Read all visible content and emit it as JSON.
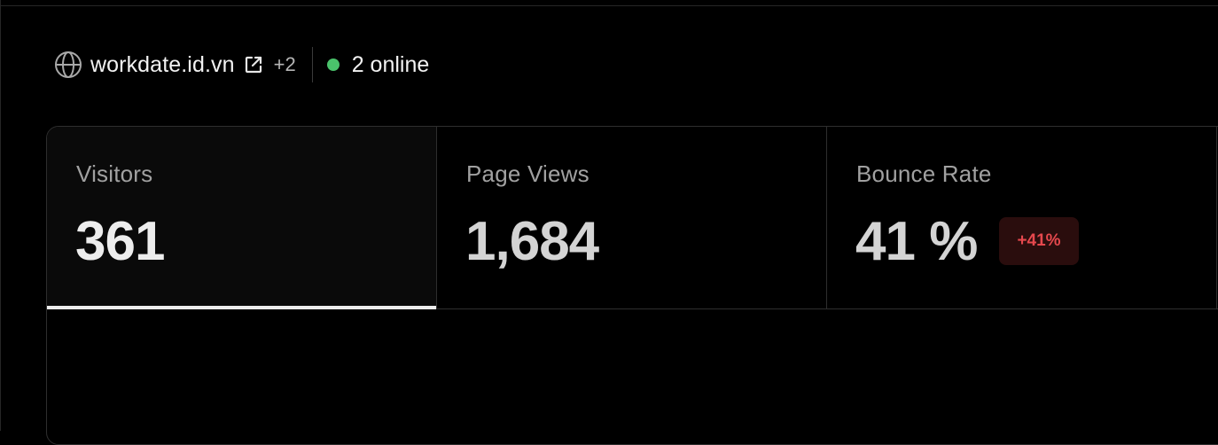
{
  "site": {
    "domain": "workdate.id.vn",
    "more_count": "+2",
    "online": "2 online",
    "icons": {
      "globe": "globe-icon",
      "external": "external-link-icon"
    },
    "online_color": "#4ac26b"
  },
  "metrics": [
    {
      "label": "Visitors",
      "value": "361",
      "active": true
    },
    {
      "label": "Page Views",
      "value": "1,684",
      "active": false
    },
    {
      "label": "Bounce Rate",
      "value": "41 %",
      "active": false,
      "change": "+41%",
      "change_color": "#e5484d"
    }
  ]
}
